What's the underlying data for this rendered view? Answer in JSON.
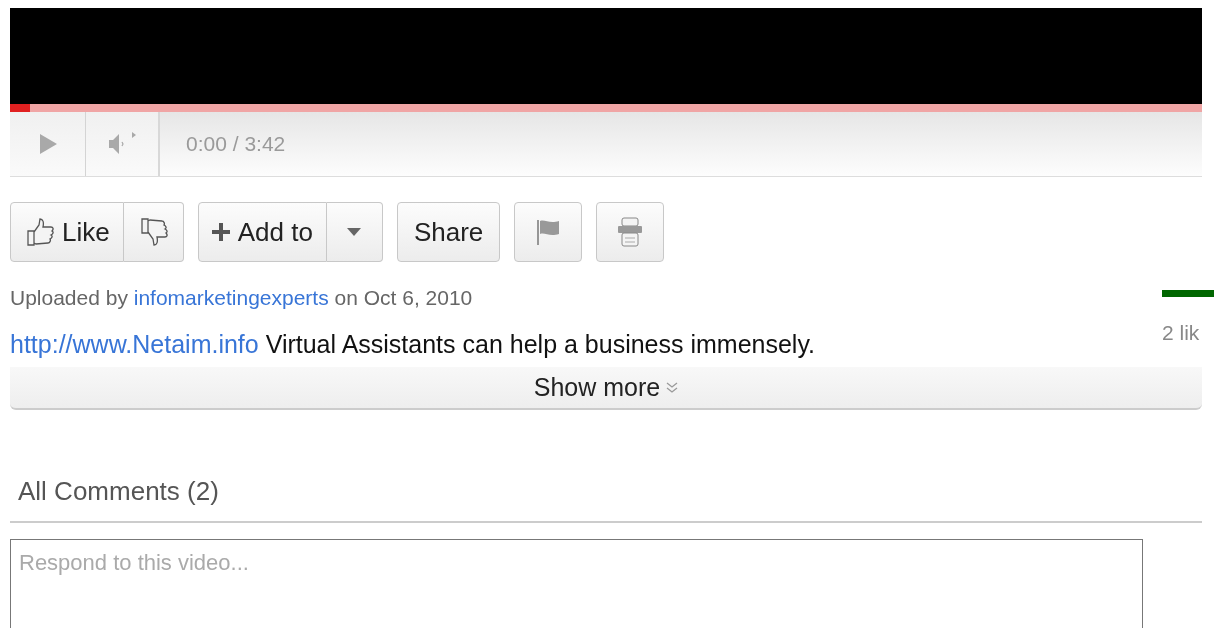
{
  "player": {
    "progress": {
      "level": 0.017
    },
    "time": "0:00 / 3:42"
  },
  "actions": [
    {
      "kind": "like",
      "label": "Like"
    },
    {
      "kind": "split-add",
      "label": "Add to"
    },
    {
      "kind": "text",
      "label": "Share"
    },
    {
      "kind": "flag"
    },
    {
      "kind": "print"
    }
  ],
  "upload": {
    "prefix": "Uploaded by",
    "user": "infomarketingexperts",
    "date": "on Oct 6, 2010"
  },
  "description": {
    "link": "http://www.Netaim.info",
    "text": "Virtual Assistants can help a business immensely."
  },
  "show_more": "Show more",
  "likes": {
    "level": 1,
    "text": "2 lik"
  },
  "comments": {
    "title": "All Comments (2)",
    "placeholder": "Respond to this video..."
  }
}
